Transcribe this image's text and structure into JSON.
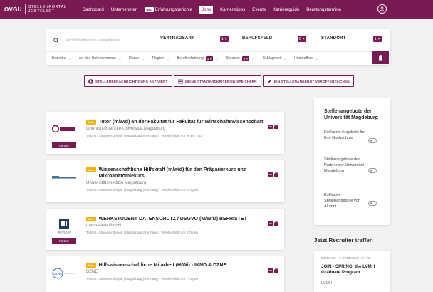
{
  "brand": {
    "main": "OVGU",
    "sub_line1": "STELLENPORTAL",
    "sub_line2": "JOBTELSET",
    "accent": "#7a1a52",
    "new_color": "#f5b400"
  },
  "nav": {
    "items": [
      {
        "label": "Dashboard"
      },
      {
        "label": "Unternehmen"
      },
      {
        "label": "Erfahrungsberichte",
        "badge": "NEU"
      },
      {
        "label": "Jobs",
        "active": true
      },
      {
        "label": "Karrieretipps"
      },
      {
        "label": "Events"
      },
      {
        "label": "Karriereguide"
      },
      {
        "label": "Beratungstermine"
      }
    ],
    "profile_icon": "user-circle-icon"
  },
  "search": {
    "placeholder": "Jetzt Unternehmen kennenlernen",
    "criteria": [
      {
        "label": "VERTRAGSART",
        "count": "1"
      },
      {
        "label": "BERUFSFELD",
        "count": "8"
      },
      {
        "label": "STANDORT",
        "count": "1"
      }
    ],
    "filters": [
      {
        "label": "Branche"
      },
      {
        "label": "Art des Unternehmens"
      },
      {
        "label": "Dauer"
      },
      {
        "label": "Region"
      },
      {
        "label": "Berufserfahrung",
        "count": "1"
      },
      {
        "label": "Sprache",
        "count": "5"
      },
      {
        "label": "Schlagwort"
      },
      {
        "label": "Homeoffice"
      }
    ],
    "remove_mark": "×"
  },
  "actions": [
    {
      "label": "STELLENBENACHRICHTIGUNG AKTIVIERT",
      "icon": "bell-icon"
    },
    {
      "label": "MEINE STANDARDKRITERIEN SPEICHERN",
      "icon": "save-icon"
    },
    {
      "label": "EIN STELLENANGEBOT VERÖFFENTLICHEN",
      "icon": "pencil-icon"
    }
  ],
  "jobs": [
    {
      "tag": "Neu",
      "title": "Tutor (m/w/d) an der Fakultät für Fakultät für Wirtschaftswissenschaft",
      "company": "Otto-von-Guericke-Universität Magdeburg",
      "meta": "Teilzeit / Studierendenjob   |   Magdeburg (Germany)   |   Veröffentlicht vor einem Tag",
      "partner": "Partner"
    },
    {
      "tag": "Neu",
      "title": "Wissenschaftliche Hilfskraft (m/w/d) für den Präparierkurs und Mikroanatomiekurs",
      "company": "Universitätsmedizin Magdeburg",
      "meta": "Teilzeit / Studierendenjob   |   Magdeburg (Germany)   |   Veröffentlicht vor 5 Tagen"
    },
    {
      "tag": "Neu",
      "title": "WERKSTUDENT DATENSCHUTZ / DSGVO (M/W/D) BEFRISTET",
      "company": "marmalade GmbH",
      "meta": "Teilzeit / Studierendenjob   |   Magdeburg (Germany)   |   Veröffentlicht vor 6 Tagen",
      "partner": "Partner",
      "logo_text": "JGROUP"
    },
    {
      "tag": "Neu",
      "title": "Hilfswissenschaftliche Mitarbeit (HiWi) - IKND & DZNE",
      "company": "DZNE",
      "meta": "Teilzeit / Studierendenjob   |   Magdeburg (Germany)   |   Veröffentlicht vor 7 Tagen",
      "logo_text": "DZNE"
    }
  ],
  "sidebar": {
    "title": "Stellenangebote der Universität Magdeburg",
    "toggles": [
      {
        "label": "Exklusive Angebote für Ihre Hochschule"
      },
      {
        "label": "Stellenangebote der Partner der Universität Magdeburg"
      },
      {
        "label": "Exklusive Stellenangebote von Alumni"
      }
    ]
  },
  "recruiter": {
    "heading": "Jetzt Recruiter treffen",
    "event_date": "MONTAG 14 FEBRUAR - 11:00",
    "event_title": "JOIN - SPRING, the LVMH Graduate Program",
    "event_company": "LVMH"
  }
}
